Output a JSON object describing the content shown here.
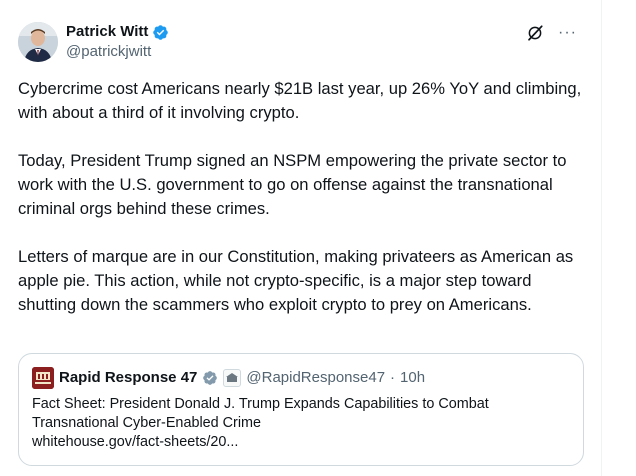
{
  "author": {
    "name": "Patrick Witt",
    "handle": "@patrickjwitt",
    "verified_color": "#1d9bf0"
  },
  "icons": {
    "grok": "grok-icon",
    "more": "more-icon",
    "more_glyph": "···"
  },
  "tweet": {
    "paragraphs": [
      "Cybercrime cost Americans nearly $21B last year, up 26% YoY and climbing, with about a third of it involving crypto.",
      "Today, President Trump signed an NSPM empowering the private sector to work with the U.S. government to go on offense against the transnational criminal orgs behind these crimes.",
      "Letters of marque are in our Constitution, making privateers as American as apple pie. This action, while not crypto-specific, is a major step toward shutting down the scammers who exploit crypto to prey on Americans."
    ]
  },
  "quote": {
    "name": "Rapid Response 47",
    "handle": "@RapidResponse47",
    "separator": "·",
    "time": "10h",
    "line1": "Fact Sheet: President Donald J. Trump Expands Capabilities to Combat",
    "line2": "Transnational Cyber-Enabled Crime",
    "link": "whitehouse.gov/fact-sheets/20..."
  }
}
